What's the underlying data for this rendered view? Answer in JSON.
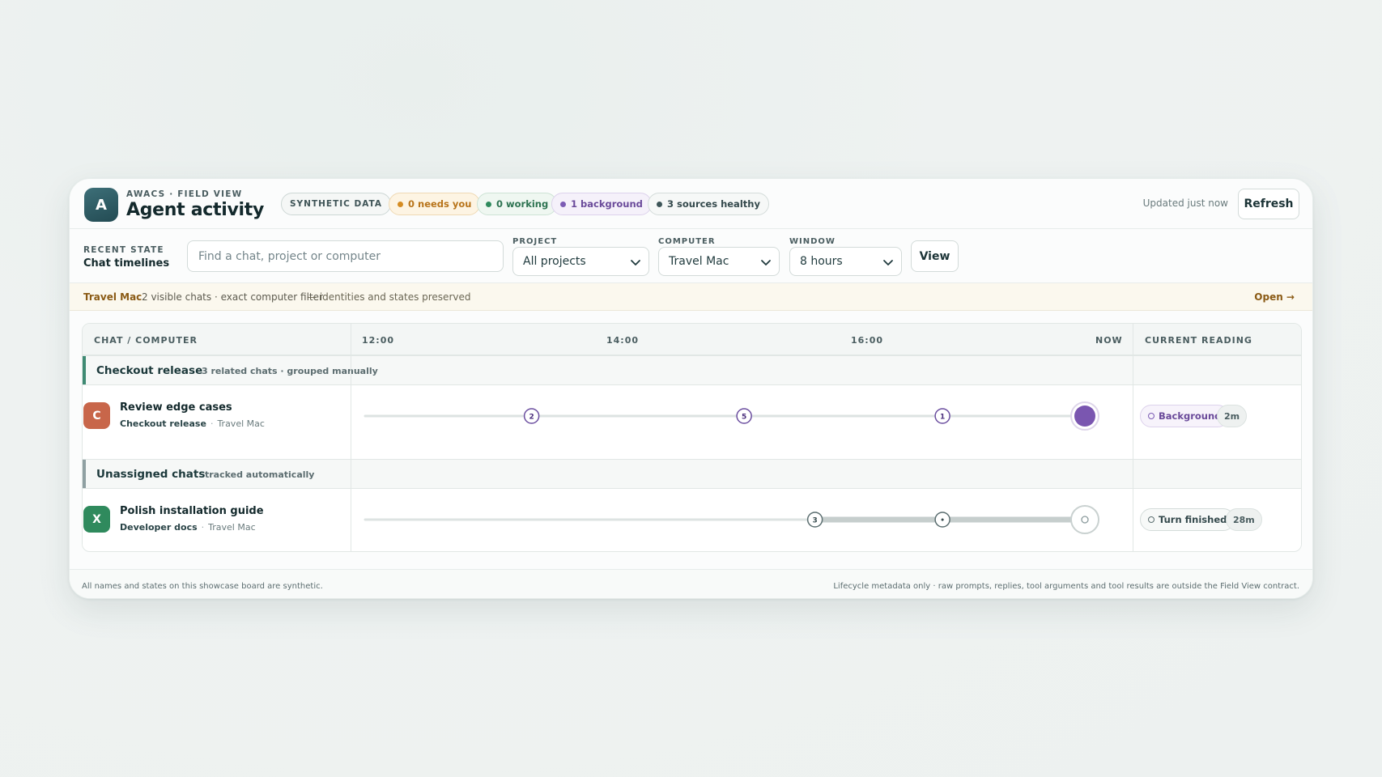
{
  "header": {
    "logo_letter": "A",
    "kicker": "AWACS · FIELD VIEW",
    "title": "Agent activity",
    "chips": {
      "synthetic": "SYNTHETIC DATA",
      "needs_you": "0 needs you",
      "working": "0 working",
      "background": "1 background",
      "sources": "3 sources healthy"
    },
    "updated": "Updated just now",
    "refresh_label": "Refresh"
  },
  "filters": {
    "recent_state_kicker": "RECENT STATE",
    "recent_state_title": "Chat timelines",
    "search_placeholder": "Find a chat, project or computer",
    "project": {
      "label": "PROJECT",
      "value": "All projects"
    },
    "computer": {
      "label": "COMPUTER",
      "value": "Travel Mac"
    },
    "window": {
      "label": "WINDOW",
      "value": "8 hours"
    },
    "view_label": "View"
  },
  "notice": {
    "computer": "Travel Mac",
    "detail": "2 visible chats · exact computer filter",
    "identities": "— identities and states preserved",
    "open_label": "Open →"
  },
  "table": {
    "columns": {
      "chat": "CHAT / COMPUTER",
      "t1": "12:00",
      "t2": "14:00",
      "t3": "16:00",
      "now": "NOW",
      "reading": "CURRENT READING"
    },
    "groups": [
      {
        "name": "Checkout release",
        "subtitle": "3 related chats · grouped manually",
        "accent": "#3f8a73",
        "rows": [
          {
            "avatar": "C",
            "avatar_color": "#c8664a",
            "name": "Review edge cases",
            "project": "Checkout release",
            "computer": "Travel Mac",
            "status": "Background",
            "age": "2m",
            "timeline": {
              "start": 0.235,
              "markers": [
                {
                  "pos": 0.235,
                  "label": "2"
                },
                {
                  "pos": 0.535,
                  "label": "5"
                },
                {
                  "pos": 0.815,
                  "label": "1"
                }
              ],
              "state": "background"
            }
          }
        ]
      },
      {
        "name": "Unassigned chats",
        "subtitle": "tracked automatically",
        "accent": "#8fa0a2",
        "rows": [
          {
            "avatar": "X",
            "avatar_color": "#2f8a5d",
            "name": "Polish installation guide",
            "project": "Developer docs",
            "computer": "Travel Mac",
            "status": "Turn finished",
            "age": "28m",
            "timeline": {
              "start": 0.635,
              "markers": [
                {
                  "pos": 0.635,
                  "label": "3"
                },
                {
                  "pos": 0.815,
                  "label": "•"
                }
              ],
              "state": "finished"
            }
          }
        ]
      }
    ]
  },
  "footer": {
    "left": "All names and states on this showcase board are synthetic.",
    "right": "Lifecycle metadata only · raw prompts, replies, tool arguments and tool results are outside the Field View contract."
  },
  "colors": {
    "accent_purple": "#7a56b0",
    "muted_track": "#c9d1d0",
    "brand_teal": "#2c5a62"
  }
}
